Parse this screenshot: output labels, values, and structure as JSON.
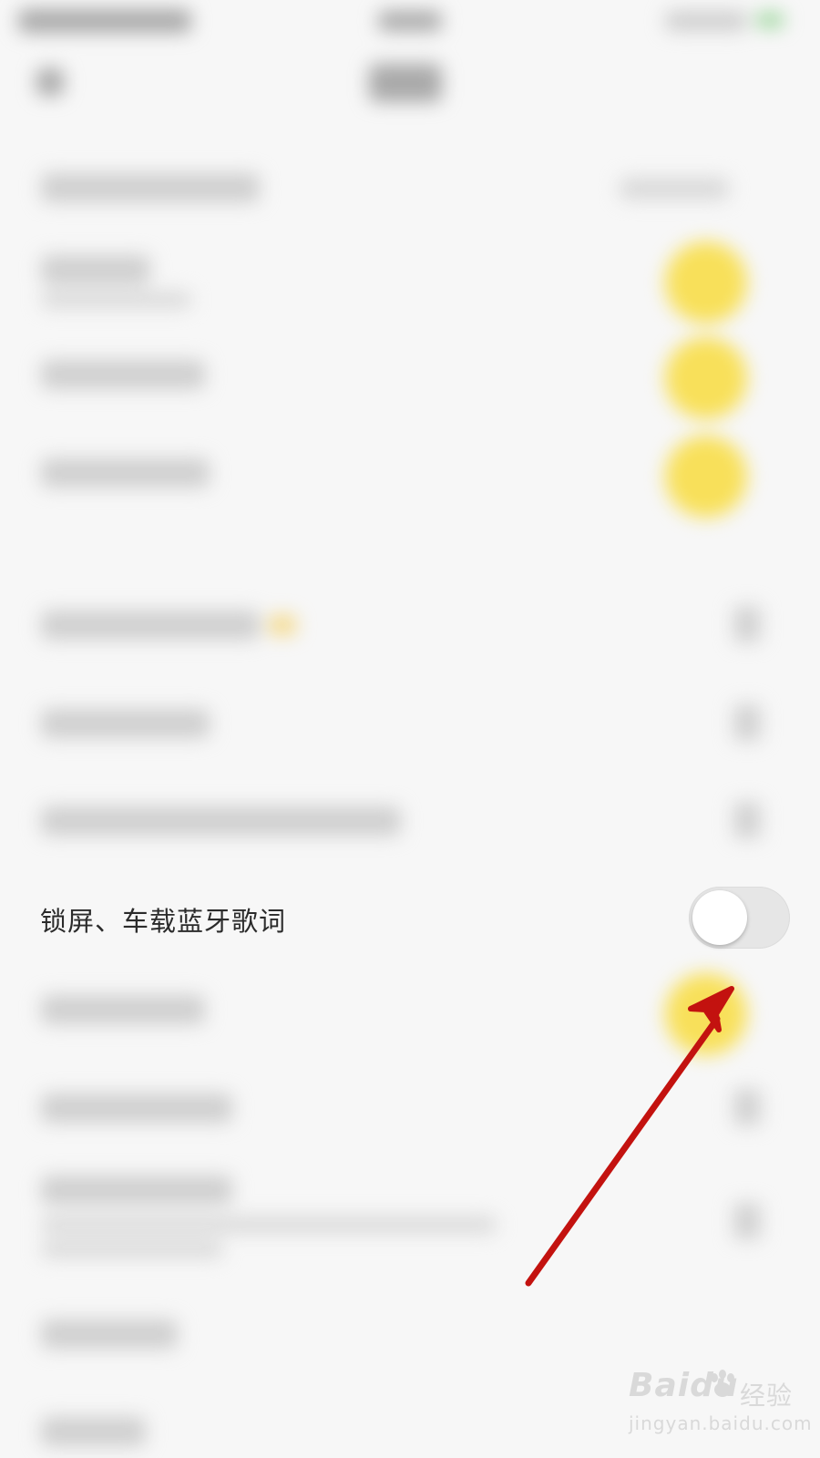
{
  "focused_setting": {
    "label": "锁屏、车载蓝牙歌词",
    "toggle_state": "off"
  },
  "watermark": {
    "logo": "Baidu",
    "product": "经验",
    "url": "jingyan.baidu.com"
  },
  "colors": {
    "background": "#f7f7f7",
    "accent_yellow": "#f8e05a",
    "toggle_off_track": "#e6e6e6",
    "annotation_arrow": "#c3120f"
  }
}
